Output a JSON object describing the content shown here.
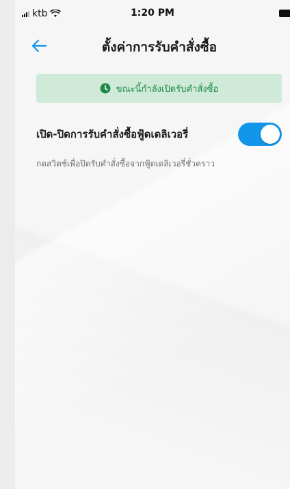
{
  "status_bar": {
    "carrier": "ktb",
    "time": "1:20 PM"
  },
  "header": {
    "title": "ตั้งค่าการรับคำสั่งซื้อ",
    "back_icon": "arrow-left-icon"
  },
  "banner": {
    "icon": "clock-icon",
    "text": "ขณะนี้กำลังเปิดรับคำสั่งซื้อ",
    "color": "#1f8a4a",
    "background": "#cfead9"
  },
  "setting": {
    "title": "เปิด-ปิดการรับคำสั่งซื้อฟู้ดเดลิเวอรี่",
    "description": "กดสวิตช์เพื่อปิดรับคำสั่งซื้อจากฟู้ดเดลิเวอรี่ชั่วคราว",
    "toggle_on": true,
    "toggle_color": "#1296e9"
  }
}
